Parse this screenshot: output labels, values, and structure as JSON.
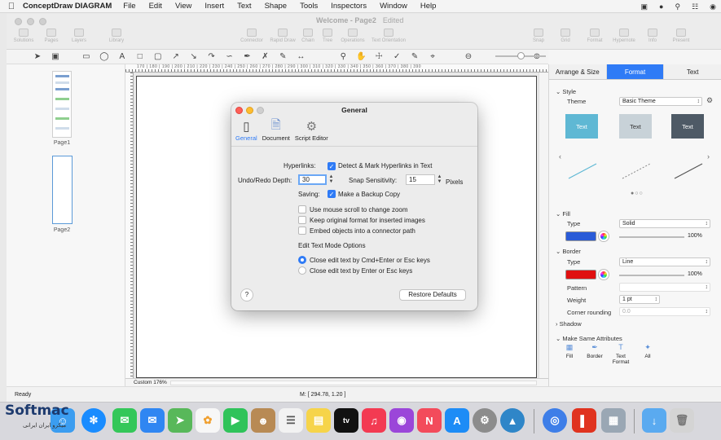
{
  "menubar": {
    "app_name": "ConceptDraw DIAGRAM",
    "items": [
      "File",
      "Edit",
      "View",
      "Insert",
      "Text",
      "Shape",
      "Tools",
      "Inspectors",
      "Window",
      "Help"
    ]
  },
  "window": {
    "title": "Welcome - Page2",
    "edited": "Edited",
    "toolbar": [
      "Solutions",
      "Pages",
      "Layers",
      "Library",
      "Connector",
      "Rapid Draw",
      "Chain",
      "Tree",
      "Operations",
      "Text Orientation",
      "Snap",
      "Grid",
      "Format",
      "Hypernote",
      "Info",
      "Present"
    ]
  },
  "pages": [
    {
      "label": "Page1"
    },
    {
      "label": "Page2"
    }
  ],
  "ruler": "170 | 180 | 190 | 200 | 210 | 220 | 230 | 240 | 250 | 260 | 270 | 280 | 290 | 300 | 310 | 320 | 330 | 340 | 350 | 360 | 370 | 380 | 390",
  "canvas": {
    "zoom_label": "Custom 176%"
  },
  "status": {
    "ready": "Ready",
    "mouse": "M: [ 294.78, 1.20 ]"
  },
  "inspector": {
    "tabs": [
      "Arrange & Size",
      "Format",
      "Text"
    ],
    "style_section": "Style",
    "theme_label": "Theme",
    "theme_value": "Basic Theme",
    "swatches": [
      {
        "text": "Text",
        "color": "#5fb8d4"
      },
      {
        "text": "Text",
        "color": "#c8d2d8"
      },
      {
        "text": "Text",
        "color": "#4e5a66"
      }
    ],
    "fill_section": "Fill",
    "fill_type_label": "Type",
    "fill_type_value": "Solid",
    "fill_color": "#2a5bd7",
    "fill_opacity": "100%",
    "border_section": "Border",
    "border_type_label": "Type",
    "border_type_value": "Line",
    "border_color": "#e01010",
    "border_opacity": "100%",
    "pattern_label": "Pattern",
    "weight_label": "Weight",
    "weight_value": "1 pt",
    "corner_label": "Corner rounding",
    "corner_value": "0.0",
    "shadow_section": "Shadow",
    "same_attr_section": "Make Same Attributes",
    "same_items": [
      "Fill",
      "Border",
      "Text Format",
      "All"
    ]
  },
  "dialog": {
    "title": "General",
    "tabs": [
      "General",
      "Document",
      "Script Editor"
    ],
    "hyperlinks_label": "Hyperlinks:",
    "hyperlinks_option": "Detect & Mark Hyperlinks in Text",
    "undo_label": "Undo/Redo Depth:",
    "undo_value": "30",
    "snap_label": "Snap Sensitivity:",
    "snap_value": "15",
    "snap_unit": "Pixels",
    "saving_label": "Saving:",
    "saving_option": "Make a Backup Copy",
    "options": [
      "Use mouse scroll to change zoom",
      "Keep original format for inserted images",
      "Embed objects into a connector path"
    ],
    "edit_mode_title": "Edit Text Mode Options",
    "radio_options": [
      "Close edit text by Cmd+Enter or Esc keys",
      "Close edit text by Enter or Esc keys"
    ],
    "help": "?",
    "restore": "Restore Defaults"
  },
  "watermark": {
    "text": "Softmac",
    "sub": "میکرو ایران ایرانی"
  },
  "dock": [
    {
      "name": "finder",
      "color": "#3b9df0"
    },
    {
      "name": "launchpad",
      "color": "#8a8f98"
    },
    {
      "name": "safari",
      "color": "#1a8cff"
    },
    {
      "name": "messages",
      "color": "#34c759"
    },
    {
      "name": "mail",
      "color": "#2f86f2"
    },
    {
      "name": "maps",
      "color": "#58b85a"
    },
    {
      "name": "photos",
      "color": "#f0a030"
    },
    {
      "name": "facetime",
      "color": "#2fc35a"
    },
    {
      "name": "contacts",
      "color": "#b88a54"
    },
    {
      "name": "reminders",
      "color": "#f2f2f2"
    },
    {
      "name": "notes",
      "color": "#f6d44a"
    },
    {
      "name": "tv",
      "color": "#111111"
    },
    {
      "name": "music",
      "color": "#f33a52"
    },
    {
      "name": "podcasts",
      "color": "#9b46d9"
    },
    {
      "name": "news",
      "color": "#f34b5b"
    },
    {
      "name": "appstore",
      "color": "#1d8cf6"
    },
    {
      "name": "system-prefs",
      "color": "#8c8c8c"
    },
    {
      "name": "conceptdraw",
      "color": "#2f86c8"
    },
    {
      "name": "conceptdraw-project",
      "color": "#3e7ee8"
    },
    {
      "name": "conceptdraw-office",
      "color": "#e0331f"
    },
    {
      "name": "preview",
      "color": "#9aa7b4"
    },
    {
      "name": "downloads",
      "color": "#5aaaf0"
    },
    {
      "name": "trash",
      "color": "#d4d4d4"
    }
  ]
}
